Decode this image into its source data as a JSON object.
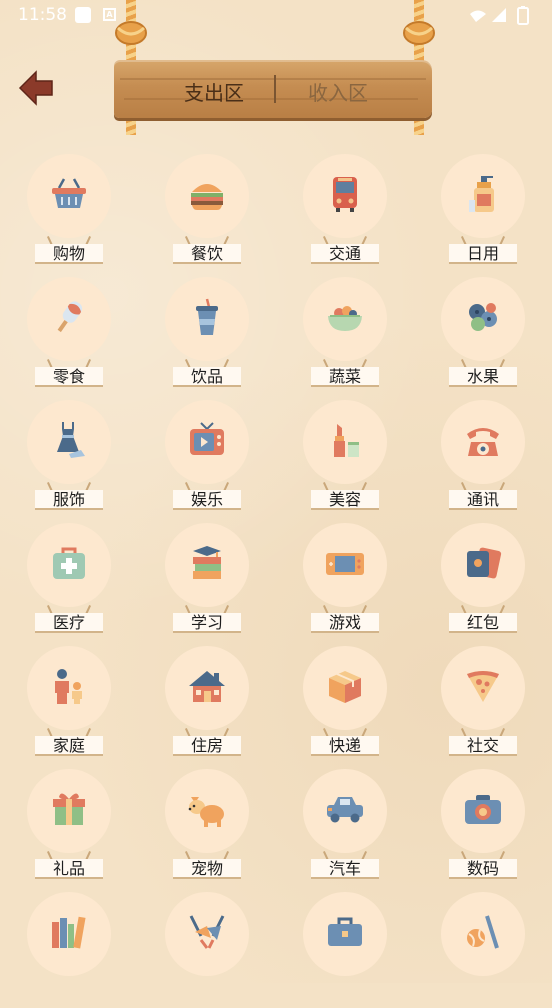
{
  "status_bar": {
    "time": "11:58"
  },
  "header": {
    "tabs": [
      {
        "label": "支出区",
        "active": true
      },
      {
        "label": "收入区",
        "active": false
      }
    ]
  },
  "categories": [
    {
      "label": "购物",
      "icon": "shopping-basket-icon"
    },
    {
      "label": "餐饮",
      "icon": "burger-icon"
    },
    {
      "label": "交通",
      "icon": "bus-icon"
    },
    {
      "label": "日用",
      "icon": "soap-bottle-icon"
    },
    {
      "label": "零食",
      "icon": "popsicle-icon"
    },
    {
      "label": "饮品",
      "icon": "drink-cup-icon"
    },
    {
      "label": "蔬菜",
      "icon": "vegetable-bowl-icon"
    },
    {
      "label": "水果",
      "icon": "fruit-icon"
    },
    {
      "label": "服饰",
      "icon": "dress-icon"
    },
    {
      "label": "娱乐",
      "icon": "tv-icon"
    },
    {
      "label": "美容",
      "icon": "lipstick-icon"
    },
    {
      "label": "通讯",
      "icon": "telephone-icon"
    },
    {
      "label": "医疗",
      "icon": "medical-kit-icon"
    },
    {
      "label": "学习",
      "icon": "books-cap-icon"
    },
    {
      "label": "游戏",
      "icon": "game-console-icon"
    },
    {
      "label": "红包",
      "icon": "red-envelope-icon"
    },
    {
      "label": "家庭",
      "icon": "family-icon"
    },
    {
      "label": "住房",
      "icon": "house-icon"
    },
    {
      "label": "快递",
      "icon": "package-icon"
    },
    {
      "label": "社交",
      "icon": "pizza-icon"
    },
    {
      "label": "礼品",
      "icon": "gift-icon"
    },
    {
      "label": "宠物",
      "icon": "dog-icon"
    },
    {
      "label": "汽车",
      "icon": "car-icon"
    },
    {
      "label": "数码",
      "icon": "camera-icon"
    },
    {
      "label": "",
      "icon": "book-shelf-icon"
    },
    {
      "label": "",
      "icon": "party-icon"
    },
    {
      "label": "",
      "icon": "briefcase-icon"
    },
    {
      "label": "",
      "icon": "sports-ball-icon"
    }
  ],
  "colors": {
    "background": "#f4e2c6",
    "circle": "#fde8cf",
    "board": "#c58d52",
    "rope": "#e8a14a",
    "back_arrow": "#8b3a2a"
  }
}
